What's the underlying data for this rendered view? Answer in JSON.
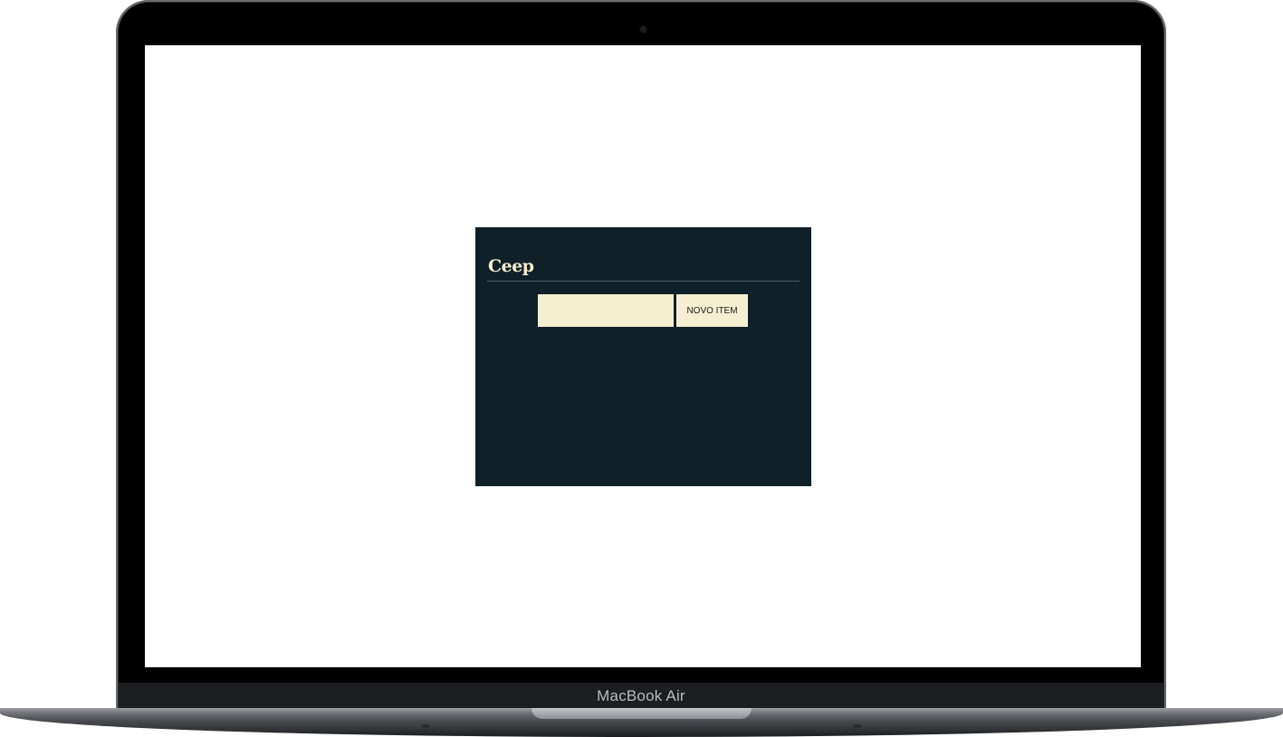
{
  "device": {
    "model_label": "MacBook Air"
  },
  "app": {
    "title": "Ceep",
    "new_item_input": {
      "value": "",
      "placeholder": ""
    },
    "new_item_button_label": "NOVO ITEM"
  },
  "colors": {
    "app_background": "#102028",
    "accent_cream": "#f5efd2",
    "title_text": "#f4edcf"
  }
}
